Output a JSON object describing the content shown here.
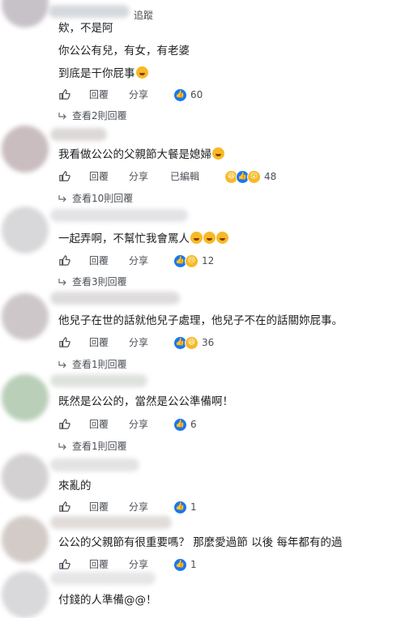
{
  "header": {
    "follow_label": "追蹤"
  },
  "comments": [
    {
      "lines": [
        "欸，不是阿",
        "你公公有兒，有女，有老婆",
        "到底是干你屁事"
      ],
      "actions": {
        "reply": "回覆",
        "share": "分享"
      },
      "reaction_count": "60",
      "reactions": [
        "like"
      ],
      "view_replies": "查看2則回覆"
    },
    {
      "lines": [
        "我看做公公的父親節大餐是媳婦"
      ],
      "actions": {
        "reply": "回覆",
        "share": "分享",
        "edited": "已編輯"
      },
      "reaction_count": "48",
      "reactions": [
        "haha",
        "like",
        "wow"
      ],
      "view_replies": "查看10則回覆"
    },
    {
      "lines": [
        "一起弄啊，不幫忙我會罵人"
      ],
      "actions": {
        "reply": "回覆",
        "share": "分享"
      },
      "reaction_count": "12",
      "reactions": [
        "like",
        "sad"
      ],
      "view_replies": "查看3則回覆"
    },
    {
      "lines": [
        "他兒子在世的話就他兒子處理，他兒子不在的話關妳屁事。"
      ],
      "actions": {
        "reply": "回覆",
        "share": "分享"
      },
      "reaction_count": "36",
      "reactions": [
        "like",
        "haha"
      ],
      "view_replies": "查看1則回覆"
    },
    {
      "lines": [
        "既然是公公的，當然是公公準備啊！"
      ],
      "actions": {
        "reply": "回覆",
        "share": "分享"
      },
      "reaction_count": "6",
      "reactions": [
        "like"
      ],
      "view_replies": "查看1則回覆"
    },
    {
      "lines": [
        "來亂的"
      ],
      "actions": {
        "reply": "回覆",
        "share": "分享"
      },
      "reaction_count": "1",
      "reactions": [
        "like"
      ]
    },
    {
      "lines": [
        "公公的父親節有很重要嗎？ 那麼愛過節 以後 每年都有的過"
      ],
      "actions": {
        "reply": "回覆",
        "share": "分享"
      },
      "reaction_count": "1",
      "reactions": [
        "like"
      ]
    },
    {
      "lines": [
        "付錢的人準備@@！"
      ]
    }
  ],
  "icons": {
    "like": "thumbs-up-icon",
    "reply_arrow": "reply-arrow-icon",
    "reactions": {
      "like": "#1877f2",
      "haha": "#f7b928",
      "wow": "#f7b928",
      "sad": "#f7b928"
    }
  }
}
